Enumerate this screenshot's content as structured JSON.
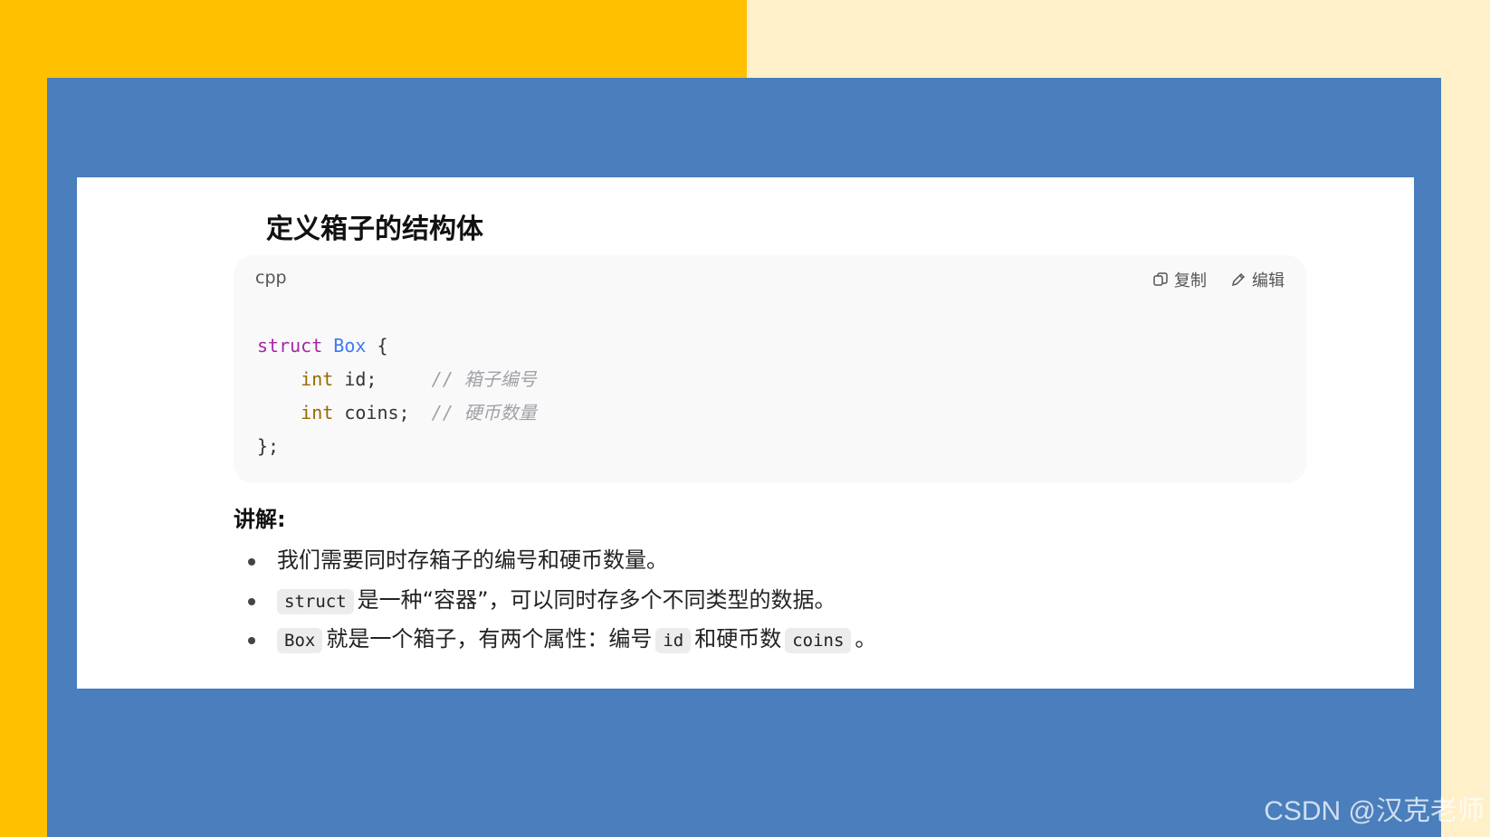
{
  "heading": "定义箱子的结构体",
  "code_block": {
    "language": "cpp",
    "copy_label": "复制",
    "edit_label": "编辑",
    "copy_icon": "copy-icon",
    "edit_icon": "pencil-icon",
    "line1": {
      "kw": "struct",
      "name": "Box",
      "rest": " {"
    },
    "line2": {
      "indent": "    ",
      "type": "int",
      "decl": " id;     ",
      "comment": "// 箱子编号"
    },
    "line3": {
      "indent": "    ",
      "type": "int",
      "decl": " coins;  ",
      "comment": "// 硬币数量"
    },
    "line4": "};"
  },
  "explain": {
    "title": "讲解:",
    "bullet1": "我们需要同时存箱子的编号和硬币数量。",
    "bullet2": {
      "code": "struct",
      "text": "是一种“容器”，可以同时存多个不同类型的数据。"
    },
    "bullet3": {
      "code1": "Box",
      "text1": "就是一个箱子，有两个属性：编号",
      "code2": "id",
      "text2": "和硬币数",
      "code3": "coins",
      "text3": "。"
    }
  },
  "watermark": "CSDN @汉克老师",
  "colors": {
    "left_bg": "#ffc000",
    "right_bg": "#fff0ca",
    "panel": "#4a7ebc",
    "keyword": "#a626a4",
    "type_name": "#4078f2",
    "int_type": "#986801",
    "comment": "#a0a1a7"
  }
}
